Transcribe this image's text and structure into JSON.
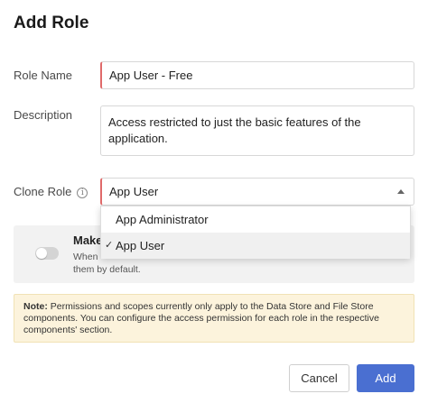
{
  "dialog": {
    "title": "Add Role"
  },
  "form": {
    "role_name": {
      "label": "Role Name",
      "value": "App User - Free"
    },
    "description": {
      "label": "Description",
      "value": "Access restricted to just the basic features of the application."
    },
    "clone_role": {
      "label": "Clone Role",
      "info_glyph": "i",
      "value": "App User",
      "options": [
        {
          "label": "App Administrator",
          "selected": false
        },
        {
          "label": "App User",
          "selected": true
        }
      ],
      "check_glyph": "✓"
    }
  },
  "make_default": {
    "title": "Make",
    "description_part1": "When",
    "description_part2": "them by default.",
    "toggle_on": false
  },
  "note": {
    "prefix": "Note:",
    "text": "Permissions and scopes currently only apply to the Data Store and File Store components. You can configure the access permission for each role in the respective components' section."
  },
  "actions": {
    "cancel": "Cancel",
    "add": "Add"
  },
  "colors": {
    "primary": "#4a6fd1",
    "required_marker": "#e06a6a",
    "note_bg": "#fcf3dc"
  }
}
